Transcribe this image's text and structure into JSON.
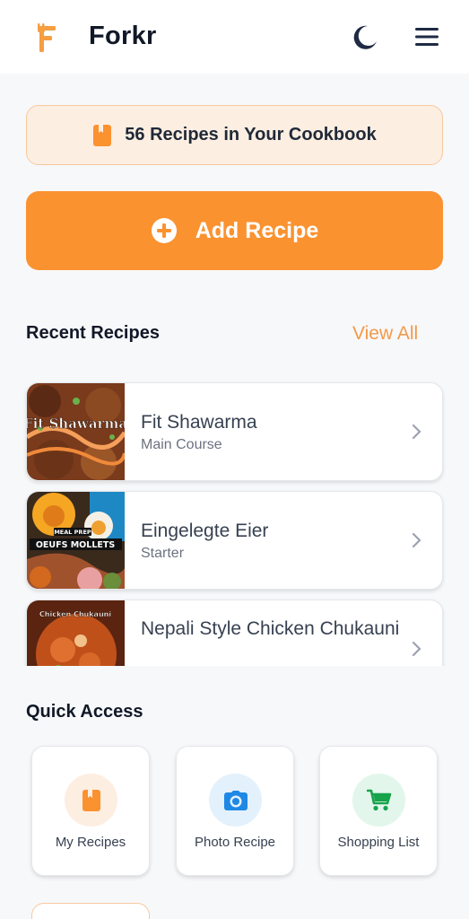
{
  "header": {
    "app_title": "Forkr",
    "logo_icon": "fork-logo-icon",
    "theme_icon": "moon-icon",
    "menu_icon": "hamburger-menu-icon"
  },
  "banner": {
    "text": "56 Recipes in Your Cookbook",
    "icon": "book-icon"
  },
  "add_button": {
    "label": "Add Recipe",
    "icon": "plus-circle-icon"
  },
  "recent": {
    "title": "Recent Recipes",
    "view_all": "View All",
    "items": [
      {
        "title": "Fit Shawarma",
        "category": "Main Course",
        "thumb_text": "Fit Shawarma"
      },
      {
        "title": "Eingelegte Eier",
        "category": "Starter",
        "thumb_badge": "MEAL PREP",
        "thumb_text": "OEUFS MOLLETS"
      },
      {
        "title": "Nepali Style Chicken Chukauni",
        "category": "",
        "thumb_text": "Chicken Chukauni"
      }
    ]
  },
  "quick_access": {
    "title": "Quick Access",
    "items": [
      {
        "label": "My Recipes",
        "icon": "book-icon"
      },
      {
        "label": "Photo Recipe",
        "icon": "camera-icon"
      },
      {
        "label": "Shopping List",
        "icon": "cart-icon"
      }
    ]
  },
  "colors": {
    "accent": "#fb9230",
    "banner_bg": "#fdeee2",
    "camera_blue": "#1e88e5",
    "cart_green": "#16a34a"
  }
}
